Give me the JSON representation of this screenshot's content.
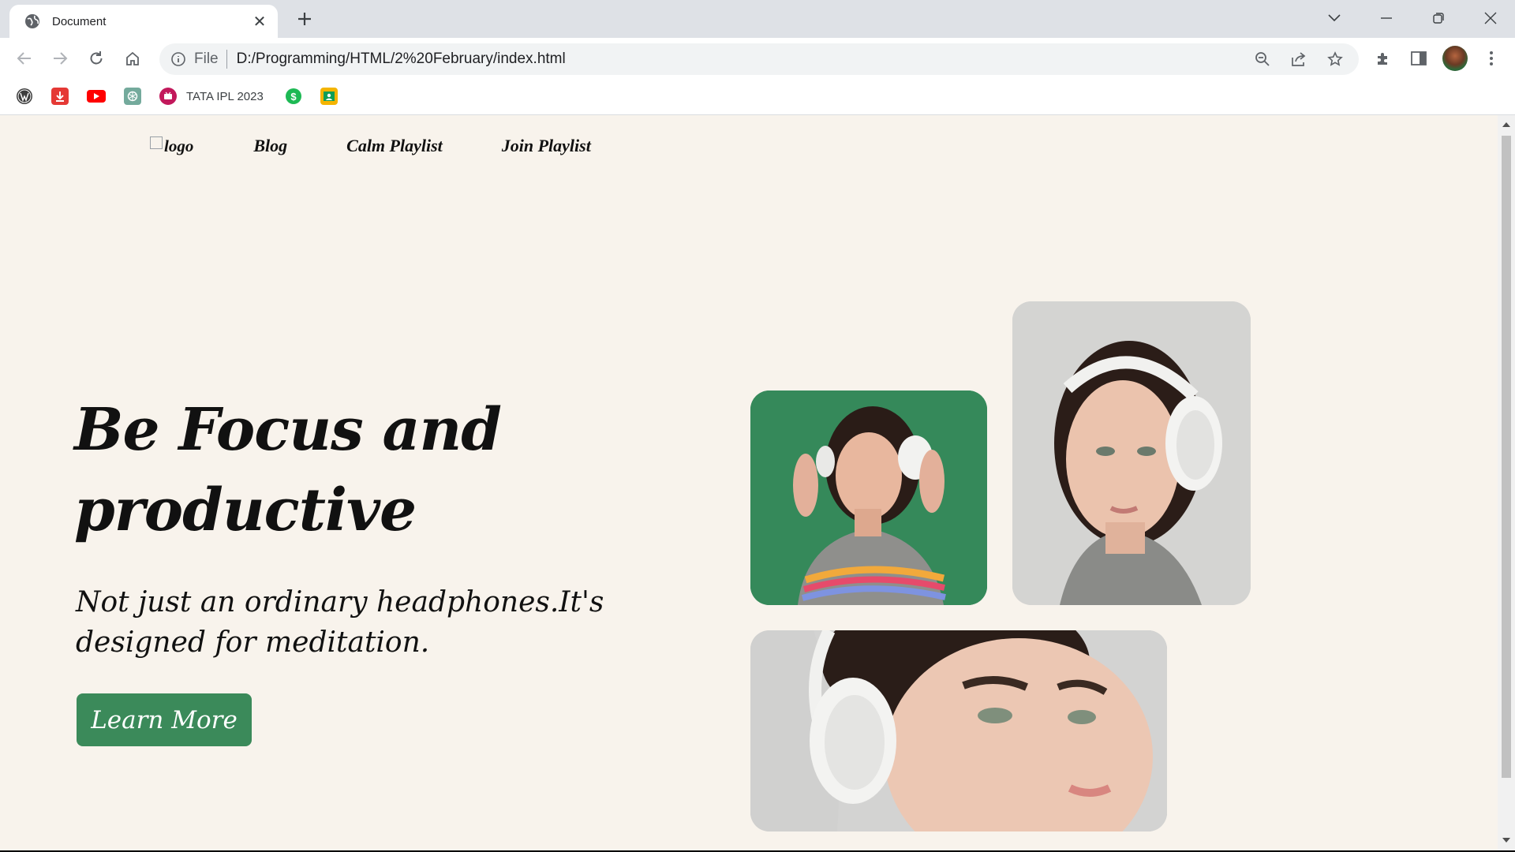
{
  "browser": {
    "tab": {
      "title": "Document",
      "favicon": "globe-icon"
    },
    "omnibox": {
      "scheme_label": "File",
      "url": "D:/Programming/HTML/2%20February/index.html"
    },
    "bookmarks": [
      {
        "icon": "wordpress-icon",
        "label": ""
      },
      {
        "icon": "download-icon",
        "label": ""
      },
      {
        "icon": "youtube-icon",
        "label": ""
      },
      {
        "icon": "chatgpt-icon",
        "label": ""
      },
      {
        "icon": "jiocinema-icon",
        "label": "TATA IPL 2023"
      },
      {
        "icon": "dollar-icon",
        "label": ""
      },
      {
        "icon": "google-classroom-icon",
        "label": ""
      }
    ]
  },
  "page": {
    "nav": {
      "logo_alt": "logo",
      "links": [
        "Blog",
        "Calm Playlist",
        "Join Playlist"
      ]
    },
    "hero": {
      "title_line1": "Be Focus and",
      "title_line2": "productive",
      "subtitle": "Not just an ordinary headphones.It's designed for meditation.",
      "cta_label": "Learn More"
    },
    "colors": {
      "background": "#f8f3ec",
      "accent": "#3b8a5a",
      "text": "#111111"
    }
  }
}
